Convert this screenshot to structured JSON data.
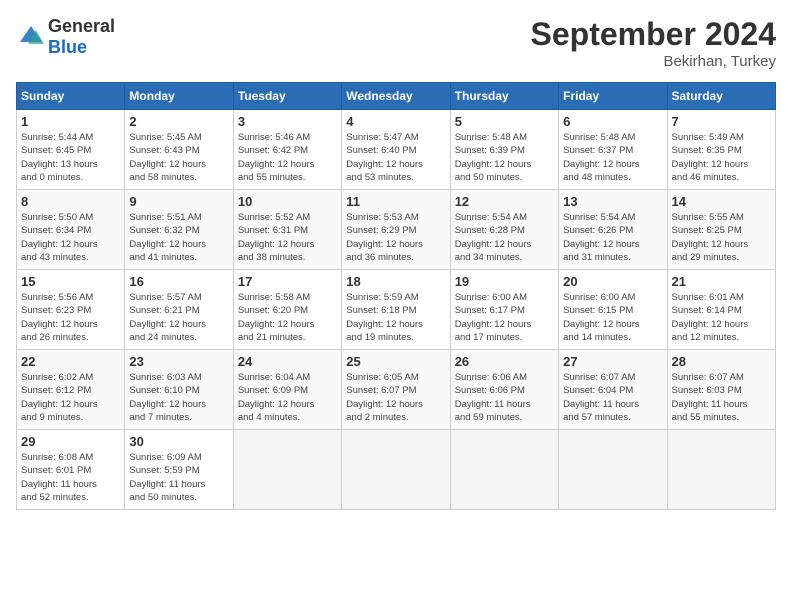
{
  "header": {
    "logo_general": "General",
    "logo_blue": "Blue",
    "month": "September 2024",
    "location": "Bekirhan, Turkey"
  },
  "columns": [
    "Sunday",
    "Monday",
    "Tuesday",
    "Wednesday",
    "Thursday",
    "Friday",
    "Saturday"
  ],
  "weeks": [
    [
      {
        "day": "1",
        "info": "Sunrise: 5:44 AM\nSunset: 6:45 PM\nDaylight: 13 hours\nand 0 minutes."
      },
      {
        "day": "2",
        "info": "Sunrise: 5:45 AM\nSunset: 6:43 PM\nDaylight: 12 hours\nand 58 minutes."
      },
      {
        "day": "3",
        "info": "Sunrise: 5:46 AM\nSunset: 6:42 PM\nDaylight: 12 hours\nand 55 minutes."
      },
      {
        "day": "4",
        "info": "Sunrise: 5:47 AM\nSunset: 6:40 PM\nDaylight: 12 hours\nand 53 minutes."
      },
      {
        "day": "5",
        "info": "Sunrise: 5:48 AM\nSunset: 6:39 PM\nDaylight: 12 hours\nand 50 minutes."
      },
      {
        "day": "6",
        "info": "Sunrise: 5:48 AM\nSunset: 6:37 PM\nDaylight: 12 hours\nand 48 minutes."
      },
      {
        "day": "7",
        "info": "Sunrise: 5:49 AM\nSunset: 6:35 PM\nDaylight: 12 hours\nand 46 minutes."
      }
    ],
    [
      {
        "day": "8",
        "info": "Sunrise: 5:50 AM\nSunset: 6:34 PM\nDaylight: 12 hours\nand 43 minutes."
      },
      {
        "day": "9",
        "info": "Sunrise: 5:51 AM\nSunset: 6:32 PM\nDaylight: 12 hours\nand 41 minutes."
      },
      {
        "day": "10",
        "info": "Sunrise: 5:52 AM\nSunset: 6:31 PM\nDaylight: 12 hours\nand 38 minutes."
      },
      {
        "day": "11",
        "info": "Sunrise: 5:53 AM\nSunset: 6:29 PM\nDaylight: 12 hours\nand 36 minutes."
      },
      {
        "day": "12",
        "info": "Sunrise: 5:54 AM\nSunset: 6:28 PM\nDaylight: 12 hours\nand 34 minutes."
      },
      {
        "day": "13",
        "info": "Sunrise: 5:54 AM\nSunset: 6:26 PM\nDaylight: 12 hours\nand 31 minutes."
      },
      {
        "day": "14",
        "info": "Sunrise: 5:55 AM\nSunset: 6:25 PM\nDaylight: 12 hours\nand 29 minutes."
      }
    ],
    [
      {
        "day": "15",
        "info": "Sunrise: 5:56 AM\nSunset: 6:23 PM\nDaylight: 12 hours\nand 26 minutes."
      },
      {
        "day": "16",
        "info": "Sunrise: 5:57 AM\nSunset: 6:21 PM\nDaylight: 12 hours\nand 24 minutes."
      },
      {
        "day": "17",
        "info": "Sunrise: 5:58 AM\nSunset: 6:20 PM\nDaylight: 12 hours\nand 21 minutes."
      },
      {
        "day": "18",
        "info": "Sunrise: 5:59 AM\nSunset: 6:18 PM\nDaylight: 12 hours\nand 19 minutes."
      },
      {
        "day": "19",
        "info": "Sunrise: 6:00 AM\nSunset: 6:17 PM\nDaylight: 12 hours\nand 17 minutes."
      },
      {
        "day": "20",
        "info": "Sunrise: 6:00 AM\nSunset: 6:15 PM\nDaylight: 12 hours\nand 14 minutes."
      },
      {
        "day": "21",
        "info": "Sunrise: 6:01 AM\nSunset: 6:14 PM\nDaylight: 12 hours\nand 12 minutes."
      }
    ],
    [
      {
        "day": "22",
        "info": "Sunrise: 6:02 AM\nSunset: 6:12 PM\nDaylight: 12 hours\nand 9 minutes."
      },
      {
        "day": "23",
        "info": "Sunrise: 6:03 AM\nSunset: 6:10 PM\nDaylight: 12 hours\nand 7 minutes."
      },
      {
        "day": "24",
        "info": "Sunrise: 6:04 AM\nSunset: 6:09 PM\nDaylight: 12 hours\nand 4 minutes."
      },
      {
        "day": "25",
        "info": "Sunrise: 6:05 AM\nSunset: 6:07 PM\nDaylight: 12 hours\nand 2 minutes."
      },
      {
        "day": "26",
        "info": "Sunrise: 6:06 AM\nSunset: 6:06 PM\nDaylight: 11 hours\nand 59 minutes."
      },
      {
        "day": "27",
        "info": "Sunrise: 6:07 AM\nSunset: 6:04 PM\nDaylight: 11 hours\nand 57 minutes."
      },
      {
        "day": "28",
        "info": "Sunrise: 6:07 AM\nSunset: 6:03 PM\nDaylight: 11 hours\nand 55 minutes."
      }
    ],
    [
      {
        "day": "29",
        "info": "Sunrise: 6:08 AM\nSunset: 6:01 PM\nDaylight: 11 hours\nand 52 minutes."
      },
      {
        "day": "30",
        "info": "Sunrise: 6:09 AM\nSunset: 5:59 PM\nDaylight: 11 hours\nand 50 minutes."
      },
      {
        "day": "",
        "info": ""
      },
      {
        "day": "",
        "info": ""
      },
      {
        "day": "",
        "info": ""
      },
      {
        "day": "",
        "info": ""
      },
      {
        "day": "",
        "info": ""
      }
    ]
  ]
}
